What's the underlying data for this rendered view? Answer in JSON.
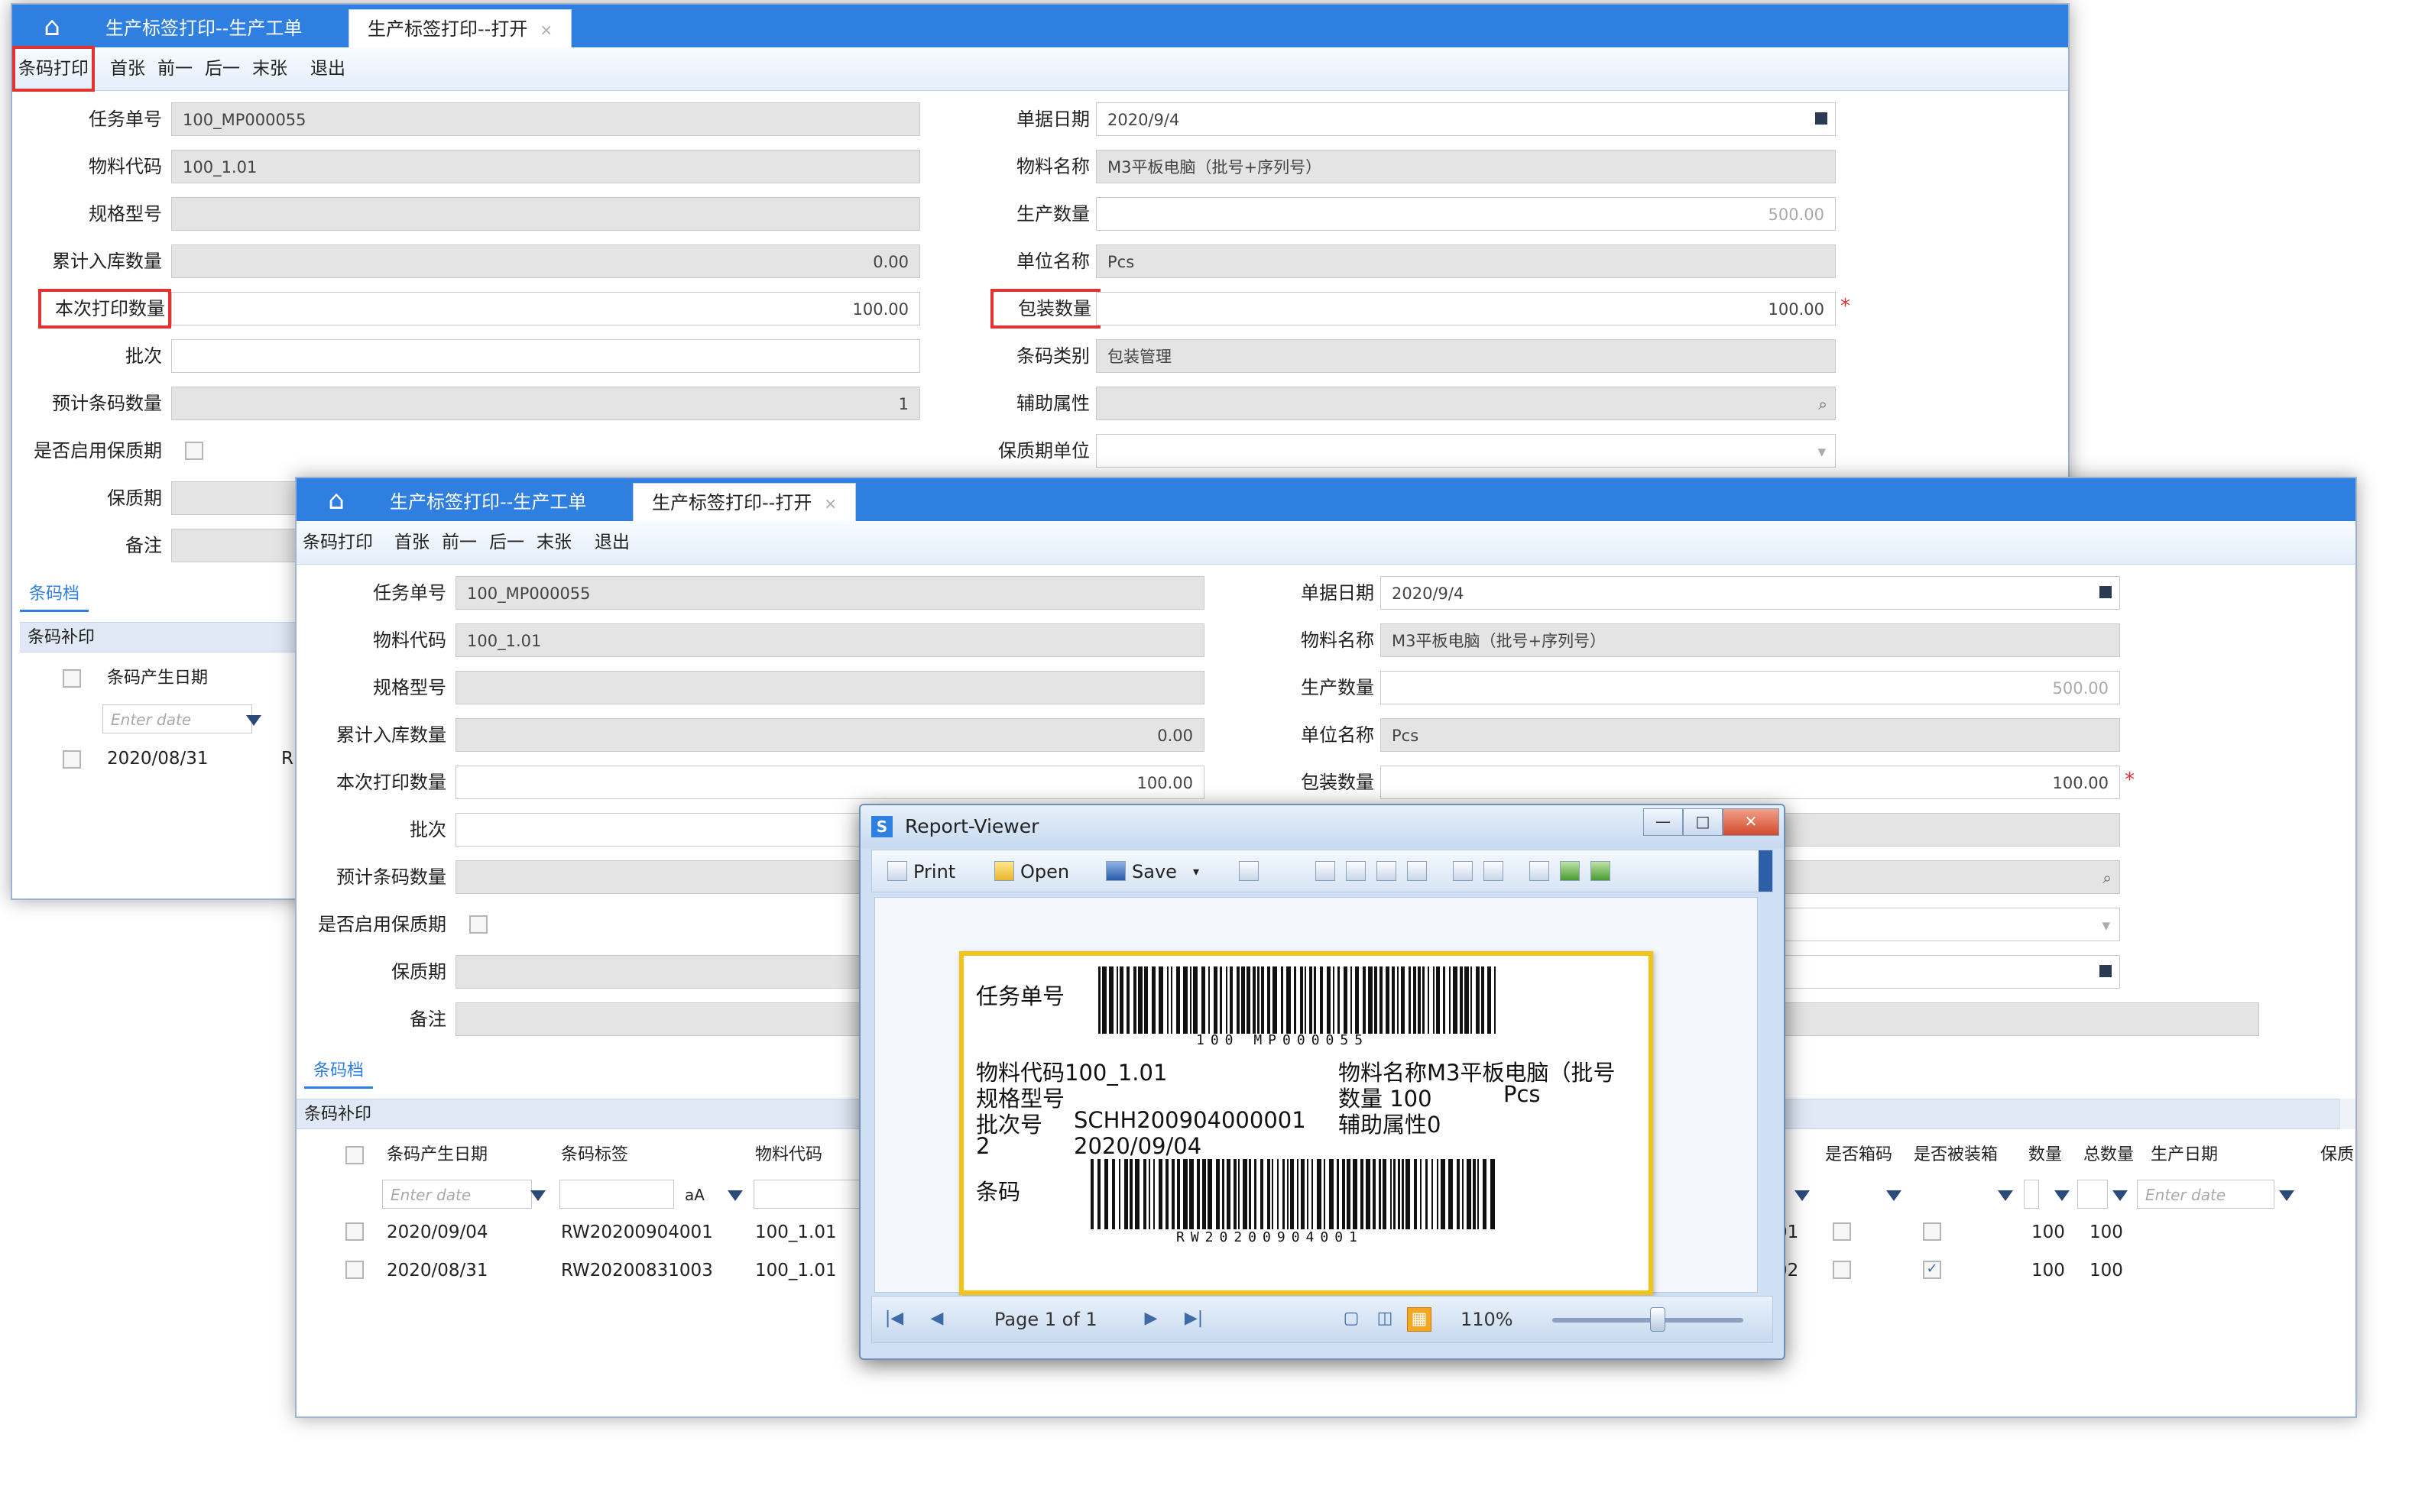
{
  "tabs": {
    "home": "⌂",
    "work_order": "生产标签打印--生产工单",
    "open": "生产标签打印--打开",
    "close": "×"
  },
  "toolbar": {
    "barcode_print": "条码打印",
    "first": "首张",
    "prev": "前一",
    "next": "后一",
    "last": "末张",
    "exit": "退出"
  },
  "form": {
    "task_no": {
      "label": "任务单号",
      "value": "100_MP000055"
    },
    "material_code": {
      "label": "物料代码",
      "value": "100_1.01"
    },
    "spec": {
      "label": "规格型号",
      "value": ""
    },
    "cum_in_qty": {
      "label": "累计入库数量",
      "value": "0.00"
    },
    "print_qty": {
      "label": "本次打印数量",
      "value": "100.00"
    },
    "batch": {
      "label": "批次",
      "value": ""
    },
    "est_barcode_qty": {
      "label": "预计条码数量",
      "value": "1"
    },
    "enable_shelf": {
      "label": "是否启用保质期"
    },
    "shelf_life": {
      "label": "保质期",
      "value": ""
    },
    "remark": {
      "label": "备注",
      "value": ""
    },
    "doc_date": {
      "label": "单据日期",
      "value": "2020/9/4"
    },
    "material_name": {
      "label": "物料名称",
      "value": "M3平板电脑（批号+序列号）"
    },
    "prod_qty": {
      "label": "生产数量",
      "value": "500.00"
    },
    "unit_name": {
      "label": "单位名称",
      "value": "Pcs"
    },
    "pack_qty": {
      "label": "包装数量",
      "value": "100.00"
    },
    "barcode_category": {
      "label": "条码类别",
      "value": "包装管理"
    },
    "aux_attr": {
      "label": "辅助属性",
      "value": ""
    },
    "shelf_unit": {
      "label": "保质期单位",
      "value": ""
    }
  },
  "barcode_section": {
    "tab": "条码档",
    "strip": "条码补印",
    "columns": [
      "条码产生日期",
      "条码标签",
      "物料代码"
    ],
    "columns_right": [
      "是否箱码",
      "是否被装箱",
      "数量",
      "总数量",
      "生产日期",
      "保质"
    ],
    "date_placeholder": "Enter date",
    "aa": "aA",
    "rows": [
      {
        "date": "2020/09/04",
        "label": "RW20200904001",
        "code": "100_1.01",
        "suffix": "01",
        "boxed": false,
        "qty": "100",
        "total": "100"
      },
      {
        "date": "2020/08/31",
        "label": "RW20200831003",
        "code": "100_1.01",
        "suffix": "02",
        "boxed": true,
        "qty": "100",
        "total": "100"
      }
    ],
    "back_row_date": "2020/08/31",
    "back_row_frag": "R"
  },
  "report_viewer": {
    "title": "Report-Viewer",
    "min": "—",
    "max": "□",
    "close": "✕",
    "print": "Print",
    "open": "Open",
    "save": "Save",
    "page": "Page 1 of 1",
    "zoom": "110%",
    "zoom_level": 0.55,
    "label": {
      "task_no_label": "任务单号",
      "barcode1_text": "100 MP000055",
      "material_code": "物料代码100_1.01",
      "material_name": "物料名称M3平板电脑（批号",
      "spec": "规格型号",
      "qty": "数量 100",
      "unit": "Pcs",
      "batch_label": "批次号",
      "batch_value": "SCHH200904000001",
      "aux": "辅助属性0",
      "batch_cont": "2",
      "date": "2020/09/04",
      "barcode_label": "条码",
      "barcode2_text": "RW20200904001"
    }
  },
  "colors": {
    "accent": "#2f7fe0",
    "highlight": "#e23232",
    "label_border": "#f2c318"
  }
}
